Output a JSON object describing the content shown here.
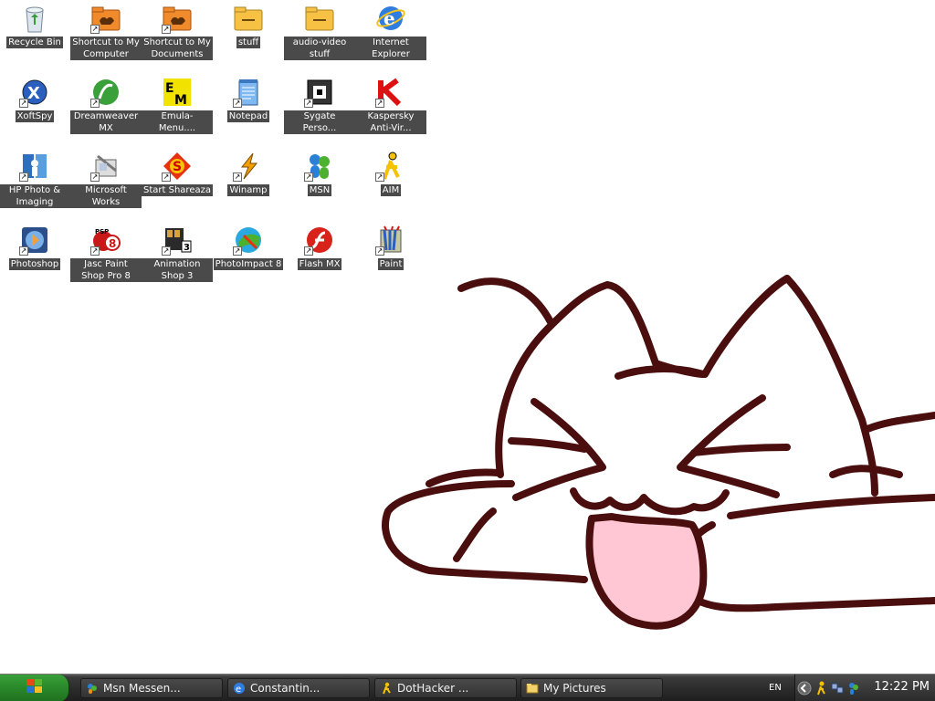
{
  "desktop": {
    "icons": [
      {
        "label": "Recycle Bin",
        "icon": "recycle-bin-icon",
        "shortcut": false
      },
      {
        "label": "Shortcut to My Computer",
        "icon": "folder-shortcut-icon",
        "shortcut": true
      },
      {
        "label": "Shortcut to My Documents",
        "icon": "folder-shortcut-icon",
        "shortcut": true
      },
      {
        "label": "stuff",
        "icon": "folder-icon",
        "shortcut": false
      },
      {
        "label": "audio-video stuff",
        "icon": "folder-icon",
        "shortcut": false
      },
      {
        "label": "Internet Explorer",
        "icon": "internet-explorer-icon",
        "shortcut": false
      },
      {
        "label": "XoftSpy",
        "icon": "xoftspy-icon",
        "shortcut": true
      },
      {
        "label": "Dreamweaver MX",
        "icon": "dreamweaver-icon",
        "shortcut": true
      },
      {
        "label": "Emula-Menu....",
        "icon": "emula-menu-icon",
        "shortcut": false
      },
      {
        "label": "Notepad",
        "icon": "notepad-icon",
        "shortcut": true
      },
      {
        "label": "Sygate Perso...",
        "icon": "sygate-icon",
        "shortcut": true
      },
      {
        "label": "Kaspersky Anti-Vir...",
        "icon": "kaspersky-icon",
        "shortcut": true
      },
      {
        "label": "HP Photo & Imaging",
        "icon": "hp-photo-icon",
        "shortcut": true
      },
      {
        "label": "Microsoft Works",
        "icon": "microsoft-works-icon",
        "shortcut": true
      },
      {
        "label": "Start Shareaza",
        "icon": "shareaza-icon",
        "shortcut": true
      },
      {
        "label": "Winamp",
        "icon": "winamp-icon",
        "shortcut": true
      },
      {
        "label": "MSN",
        "icon": "msn-icon",
        "shortcut": true
      },
      {
        "label": "AIM",
        "icon": "aim-icon",
        "shortcut": true
      },
      {
        "label": "Photoshop",
        "icon": "photoshop-icon",
        "shortcut": true
      },
      {
        "label": "Jasc Paint Shop Pro 8",
        "icon": "paint-shop-pro-icon",
        "shortcut": true
      },
      {
        "label": "Animation Shop 3",
        "icon": "animation-shop-icon",
        "shortcut": true
      },
      {
        "label": "PhotoImpact 8",
        "icon": "photoimpact-icon",
        "shortcut": true
      },
      {
        "label": "Flash MX",
        "icon": "flash-icon",
        "shortcut": true
      },
      {
        "label": "Paint",
        "icon": "paint-icon",
        "shortcut": true
      }
    ]
  },
  "taskbar": {
    "start_icon": "windows-logo-icon",
    "tasks": [
      {
        "label": "Msn Messen...",
        "icon": "msn-icon"
      },
      {
        "label": "Constantin...",
        "icon": "ie-window-icon"
      },
      {
        "label": "DotHacker ...",
        "icon": "aim-icon"
      },
      {
        "label": "My Pictures",
        "icon": "folder-window-icon"
      }
    ],
    "language": "EN",
    "clock": "12:22 PM"
  },
  "colors": {
    "label_bg": "#4a4a4a",
    "wallpaper_outline": "#4a0e0e",
    "tongue": "#ffc6d3"
  }
}
